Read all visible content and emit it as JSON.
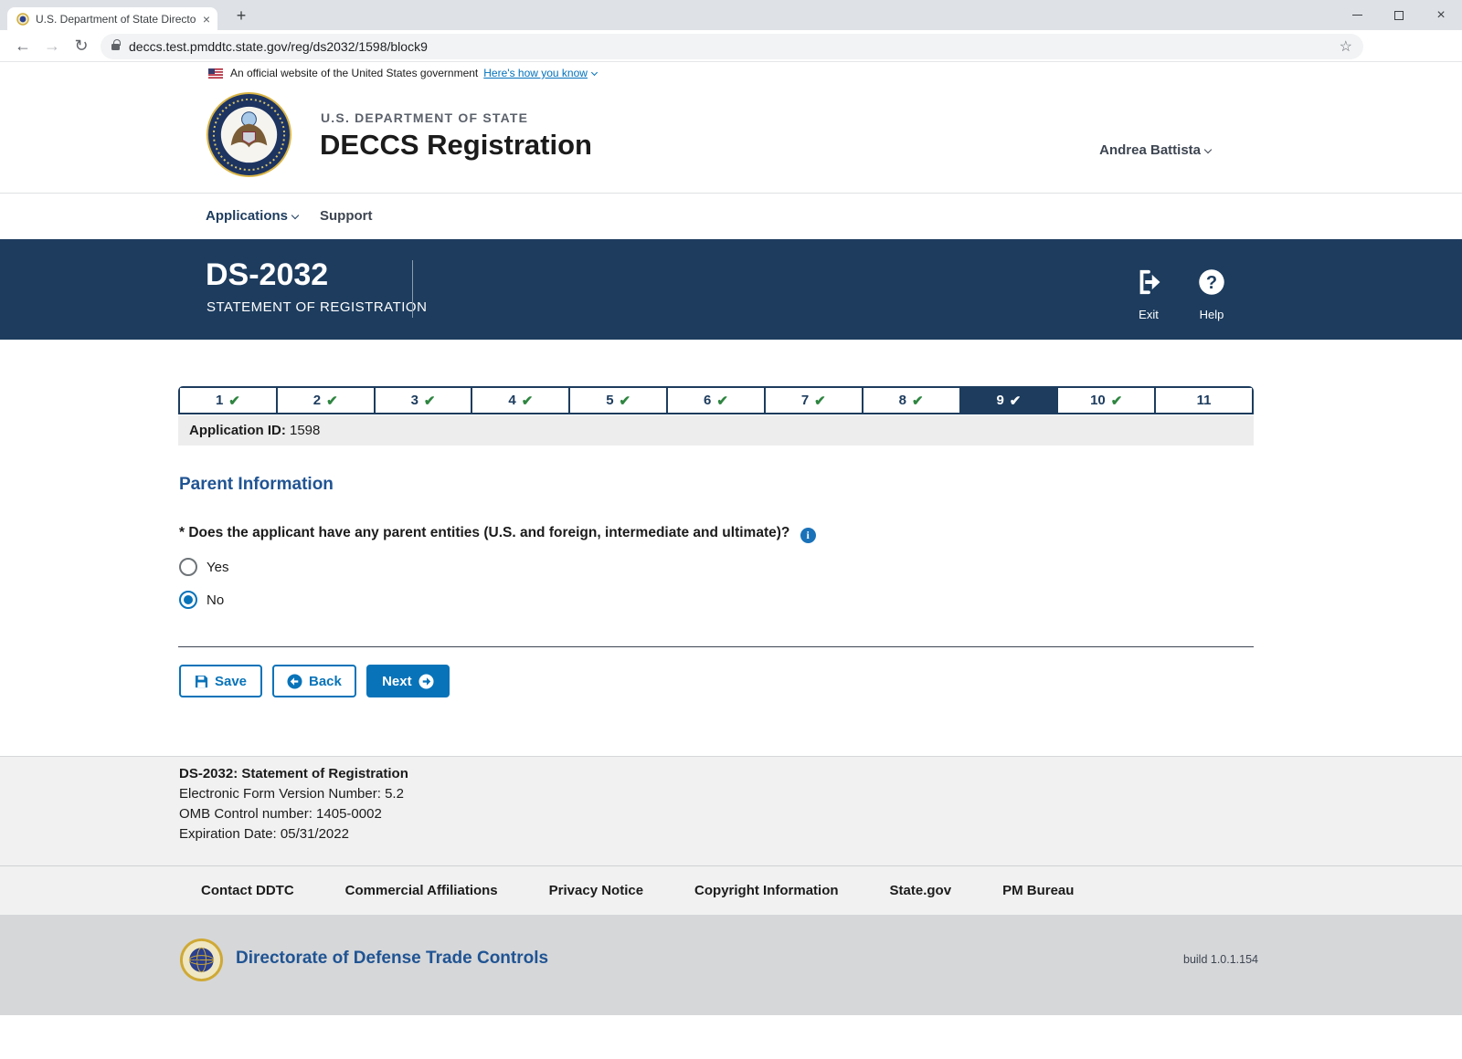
{
  "browser": {
    "tab_title": "U.S. Department of State Directo",
    "url": "deccs.test.pmddtc.state.gov/reg/ds2032/1598/block9"
  },
  "gov_banner": {
    "text": "An official website of the United States government",
    "link_label": "Here's how you know"
  },
  "header": {
    "agency": "U.S. DEPARTMENT OF STATE",
    "app_title": "DECCS Registration",
    "user_name": "Andrea Battista"
  },
  "nav": {
    "applications_label": "Applications",
    "support_label": "Support"
  },
  "form_banner": {
    "form_number": "DS-2032",
    "form_name": "STATEMENT OF REGISTRATION",
    "exit_label": "Exit",
    "help_label": "Help"
  },
  "steps": {
    "items": [
      {
        "number": "1",
        "checked": true,
        "active": false
      },
      {
        "number": "2",
        "checked": true,
        "active": false
      },
      {
        "number": "3",
        "checked": true,
        "active": false
      },
      {
        "number": "4",
        "checked": true,
        "active": false
      },
      {
        "number": "5",
        "checked": true,
        "active": false
      },
      {
        "number": "6",
        "checked": true,
        "active": false
      },
      {
        "number": "7",
        "checked": true,
        "active": false
      },
      {
        "number": "8",
        "checked": true,
        "active": false
      },
      {
        "number": "9",
        "checked": true,
        "active": true
      },
      {
        "number": "10",
        "checked": true,
        "active": false
      },
      {
        "number": "11",
        "checked": false,
        "active": false
      }
    ],
    "application_id_label": "Application ID:",
    "application_id_value": "1598"
  },
  "main": {
    "section_title": "Parent Information",
    "question": "* Does the applicant have any parent entities (U.S. and foreign, intermediate and ultimate)?",
    "options": [
      {
        "label": "Yes",
        "selected": false
      },
      {
        "label": "No",
        "selected": true
      }
    ],
    "buttons": {
      "save": "Save",
      "back": "Back",
      "next": "Next"
    }
  },
  "footer": {
    "form_info_title": "DS-2032: Statement of Registration",
    "info_lines": [
      "Electronic Form Version Number: 5.2",
      "OMB Control number: 1405-0002",
      "Expiration Date: 05/31/2022"
    ],
    "links": [
      "Contact DDTC",
      "Commercial Affiliations",
      "Privacy Notice",
      "Copyright Information",
      "State.gov",
      "PM Bureau"
    ],
    "org_name": "Directorate of Defense Trade Controls",
    "build": "build 1.0.1.154"
  },
  "icons": {
    "check": "✔",
    "close": "×",
    "star": "☆",
    "menu_dots": "⋮",
    "back_arrow": "←",
    "forward_arrow": "→",
    "reload": "↻",
    "new_tab": "+",
    "info": "i",
    "help": "?"
  },
  "colors": {
    "banner_navy": "#1d3c5e",
    "action_blue": "#0873b9",
    "check_green": "#2e8540",
    "heading_blue": "#205493",
    "footer_gray": "#d6d7d9",
    "info_gray": "#f1f1f1"
  }
}
